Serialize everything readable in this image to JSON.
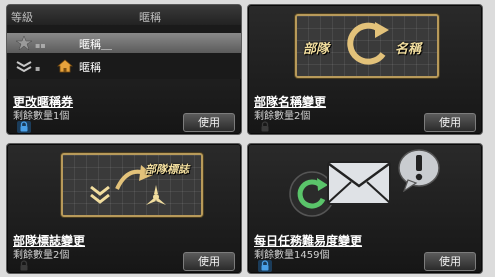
{
  "card1": {
    "table": {
      "header_rank": "等級",
      "header_nick": "暱稱",
      "row1_nick": "暱稱＿",
      "row2_nick": "暱稱"
    },
    "title": "更改暱稱券",
    "count": "剩餘數量1個",
    "use_label": "使用"
  },
  "card2": {
    "art_left": "部隊",
    "art_right": "名稱",
    "title": "部隊名稱變更",
    "count": "剩餘數量2個",
    "use_label": "使用"
  },
  "card3": {
    "art_label": "部隊標誌",
    "title": "部隊標誌變更",
    "count": "剩餘數量2個",
    "use_label": "使用"
  },
  "card4": {
    "title": "每日任務難易度變更",
    "count": "剩餘數量1459個",
    "use_label": "使用"
  },
  "colors": {
    "gold": "#c9a860",
    "card_bg": "#1e1e1e",
    "lock_blue": "#4aa0e8"
  },
  "icons": [
    "star-icon",
    "chevron-rank-icon",
    "house-icon",
    "lock-icon",
    "refresh-icon",
    "envelope-icon",
    "exclamation-bubble-icon",
    "rotate-arrow-icon"
  ]
}
